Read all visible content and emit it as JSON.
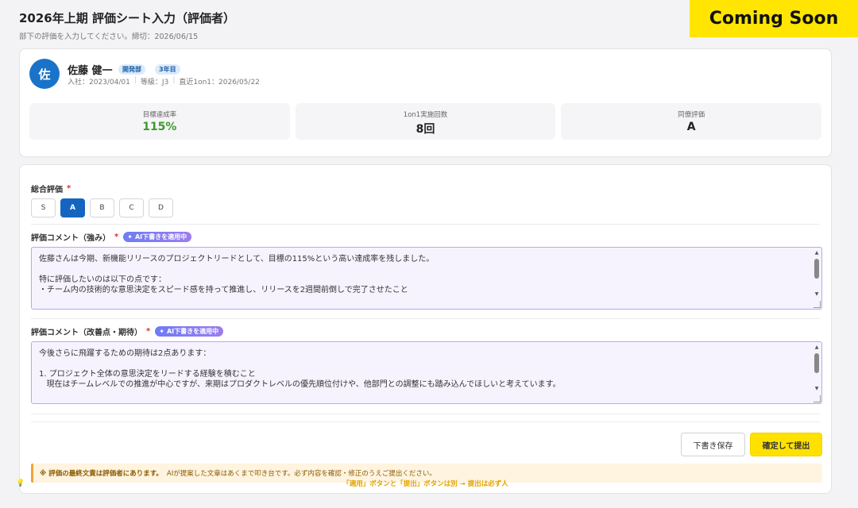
{
  "header": {
    "title": "2026年上期 評価シート入力（評価者）",
    "subtitle": "部下の評価を入力してください。締切：2026/06/15"
  },
  "banner": {
    "label": "Coming Soon"
  },
  "employee": {
    "avatar_initial": "佐",
    "name": "佐藤 健一",
    "badges": [
      "開発部",
      "3年目"
    ],
    "meta": [
      "入社：2023/04/01",
      "等級：J3",
      "直近1on1：2026/05/22"
    ],
    "stats": [
      {
        "label": "目標達成率",
        "value": "115%"
      },
      {
        "label": "1on1実施回数",
        "value": "8回"
      },
      {
        "label": "同僚評価",
        "value": "A"
      }
    ]
  },
  "form": {
    "overall_label": "総合評価",
    "required_mark": "*",
    "grades": [
      "S",
      "A",
      "B",
      "C",
      "D"
    ],
    "selected_grade": "A",
    "ai_badge_label": "AI下書きを適用中",
    "strengths_label": "評価コメント（強み）",
    "strengths_lines": [
      "佐藤さんは今期、新機能リリースのプロジェクトリードとして、目標の115%という高い達成率を残しました。",
      "",
      "特に評価したいのは以下の点です：",
      "・チーム内の技術的な意思決定をスピード感を持って推進し、リリースを2週間前倒しで完了させたこと"
    ],
    "improvement_label": "評価コメント（改善点・期待）",
    "improvement_lines": [
      "今後さらに飛躍するための期待は2点あります：",
      "",
      "1. プロジェクト全体の意思決定をリードする経験を積むこと",
      "   現在はチームレベルでの推進が中心ですが、来期はプロダクトレベルの優先順位付けや、他部門との調整にも踏み込んでほしいと考えています。"
    ],
    "save_draft_label": "下書き保存",
    "submit_label": "確定して提出",
    "notice_bold": "※ 評価の最終文責は評価者にあります。",
    "notice_text": "AIが提案した文章はあくまで叩き台です。必ず内容を確認・修正のうえご提出ください。"
  },
  "tip": {
    "icon": "lightbulb-icon",
    "text": "「適用」ボタンと「提出」ボタンは別 → 提出は必ず人"
  }
}
